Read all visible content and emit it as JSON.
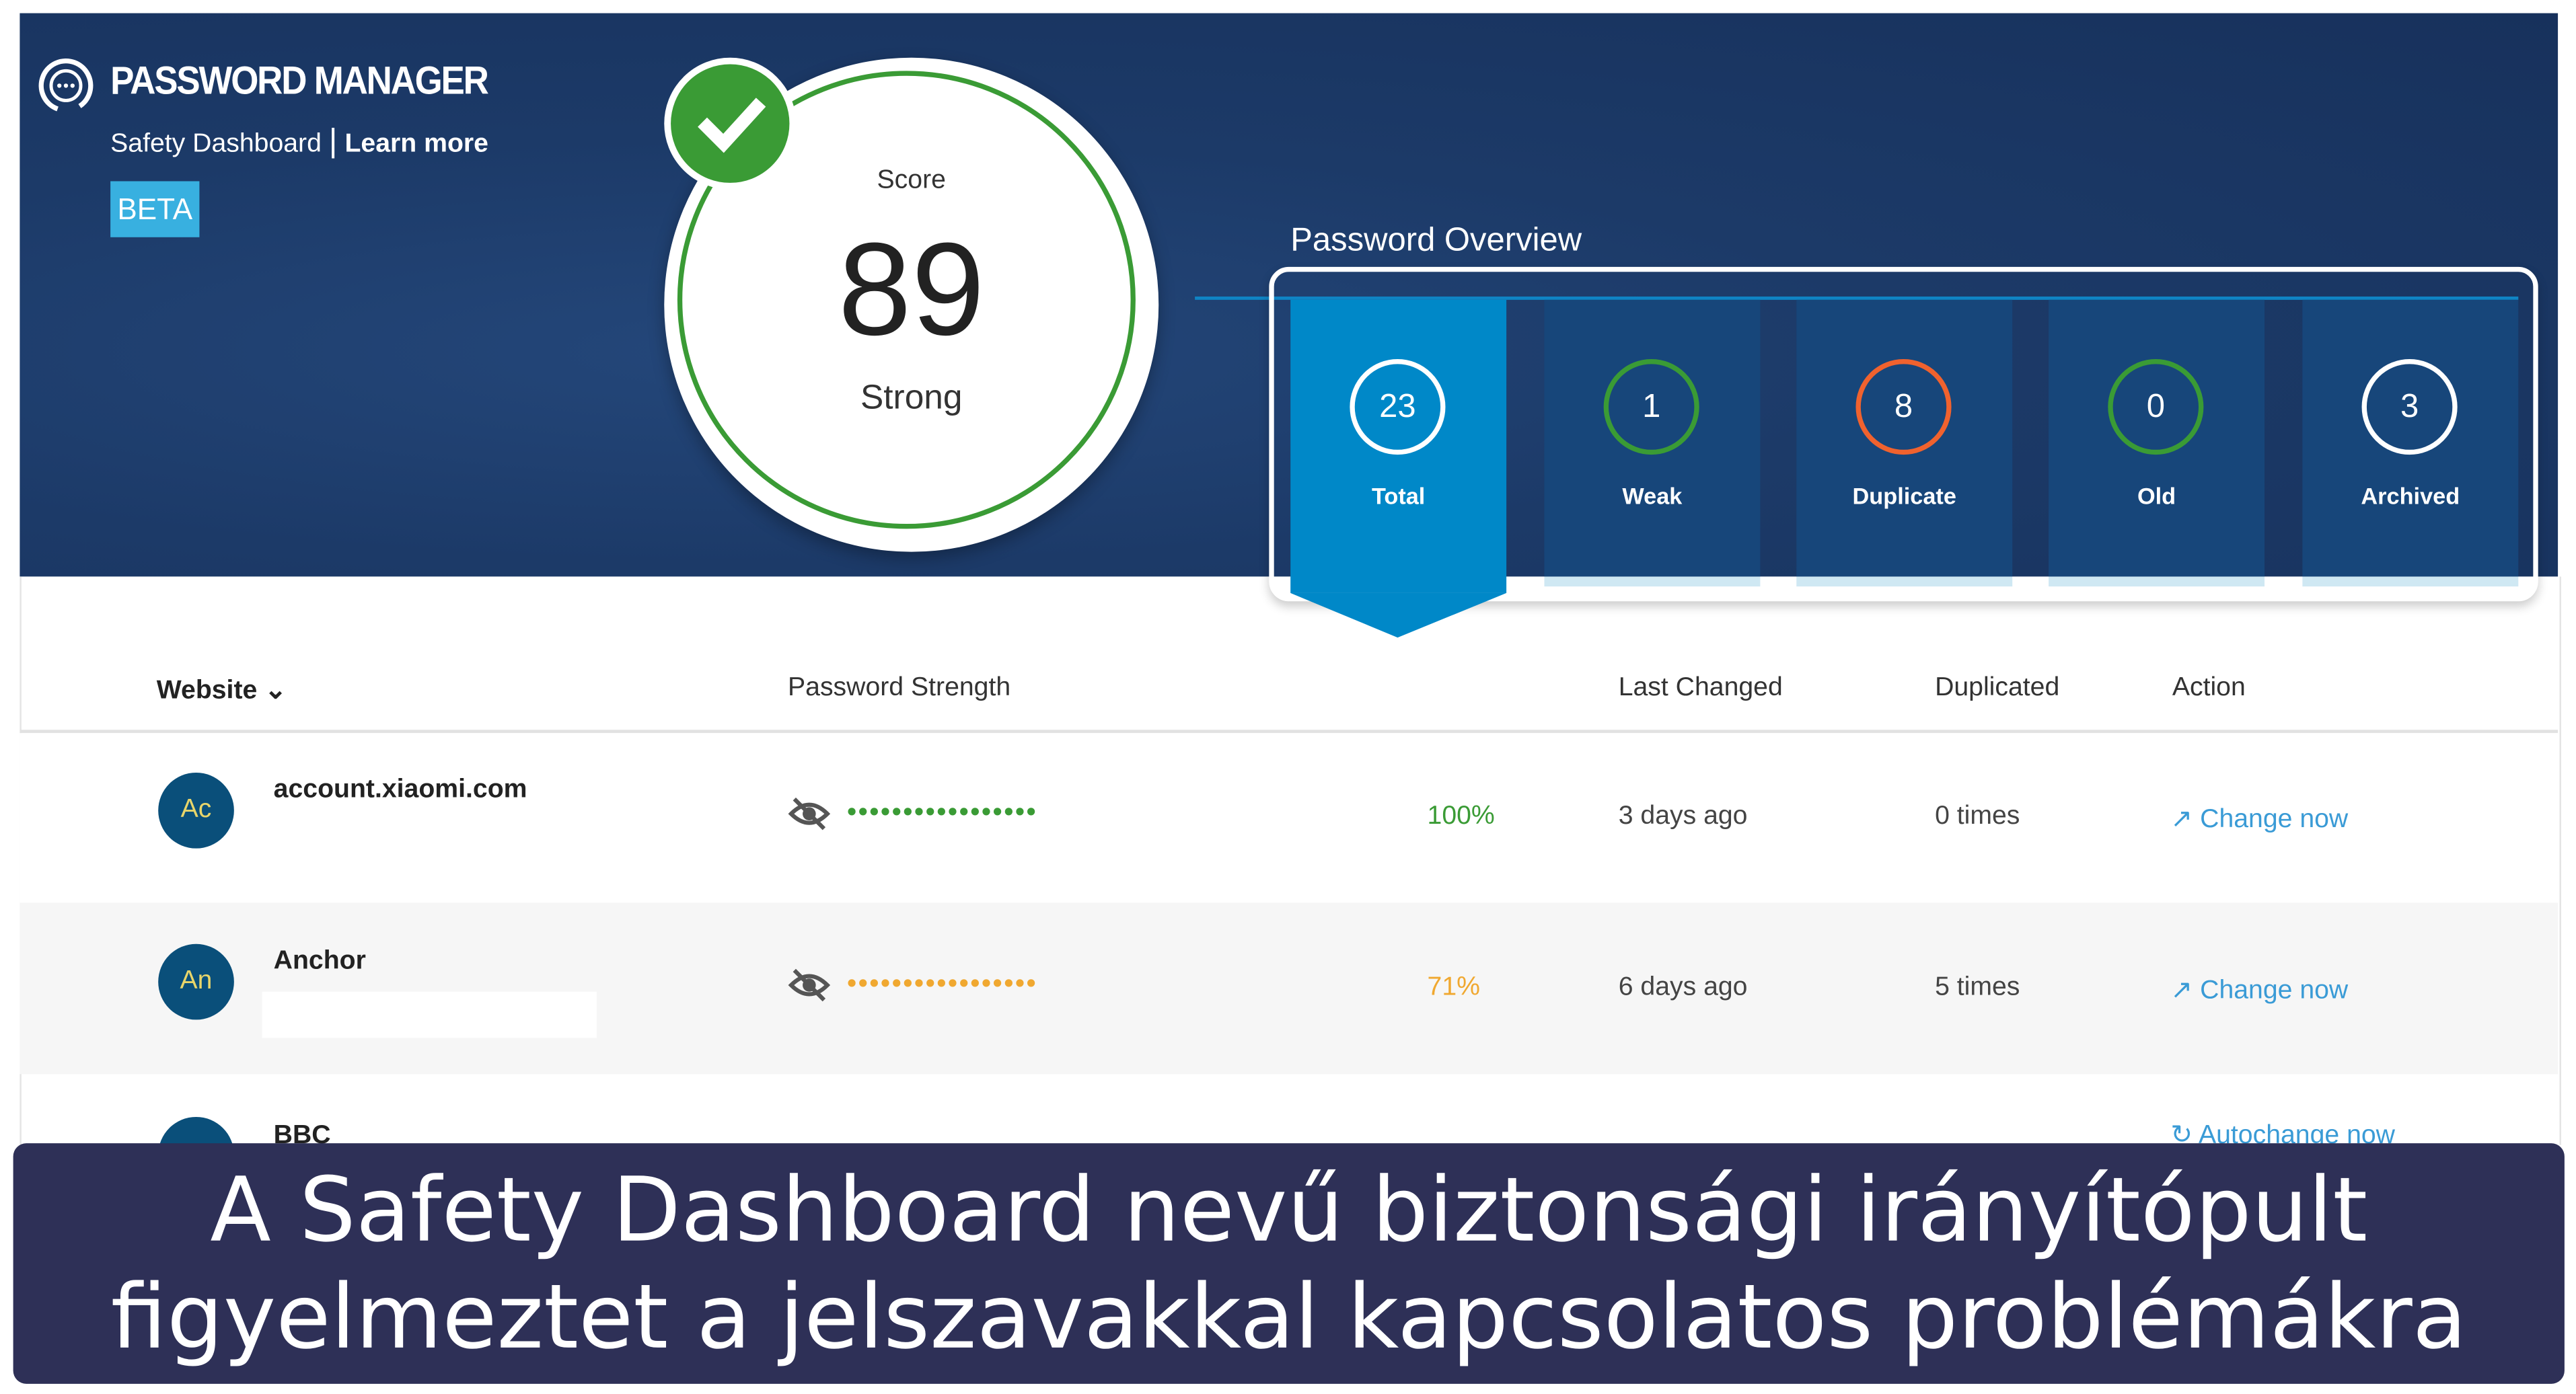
{
  "header": {
    "app_title": "PASSWORD MANAGER",
    "subtitle": "Safety Dashboard",
    "separator": "|",
    "learn_more": "Learn more",
    "badge": "BETA"
  },
  "score": {
    "label": "Score",
    "value": "89",
    "rating": "Strong",
    "color": "#3a9b35"
  },
  "overview": {
    "title": "Password Overview",
    "tiles": [
      {
        "count": "23",
        "label": "Total",
        "ring_color": "#ffffff",
        "active": true
      },
      {
        "count": "1",
        "label": "Weak",
        "ring_color": "#3a9b35"
      },
      {
        "count": "8",
        "label": "Duplicate",
        "ring_color": "#f0622e"
      },
      {
        "count": "0",
        "label": "Old",
        "ring_color": "#3a9b35"
      },
      {
        "count": "3",
        "label": "Archived",
        "ring_color": "#ffffff"
      }
    ]
  },
  "table": {
    "columns": {
      "website": "Website",
      "strength": "Password Strength",
      "last_changed": "Last Changed",
      "duplicated": "Duplicated",
      "action": "Action"
    },
    "rows": [
      {
        "initials": "Ac",
        "site": "account.xiaomi.com",
        "strength_pct": "100%",
        "strength_color": "#3a9b35",
        "last_changed": "3 days ago",
        "duplicated": "0 times",
        "action": "Change now"
      },
      {
        "initials": "An",
        "site": "Anchor",
        "strength_pct": "71%",
        "strength_color": "#f0a830",
        "last_changed": "6 days ago",
        "duplicated": "5 times",
        "action": "Change now"
      },
      {
        "initials": "",
        "site": "BBC",
        "action": "Autochange now"
      }
    ]
  },
  "dots": "•••••••••••••••••",
  "caption": {
    "line1": "A Safety Dashboard nevű biztonsági irányítópult",
    "line2": "figyelmeztet a jelszavakkal kapcsolatos problémákra"
  }
}
